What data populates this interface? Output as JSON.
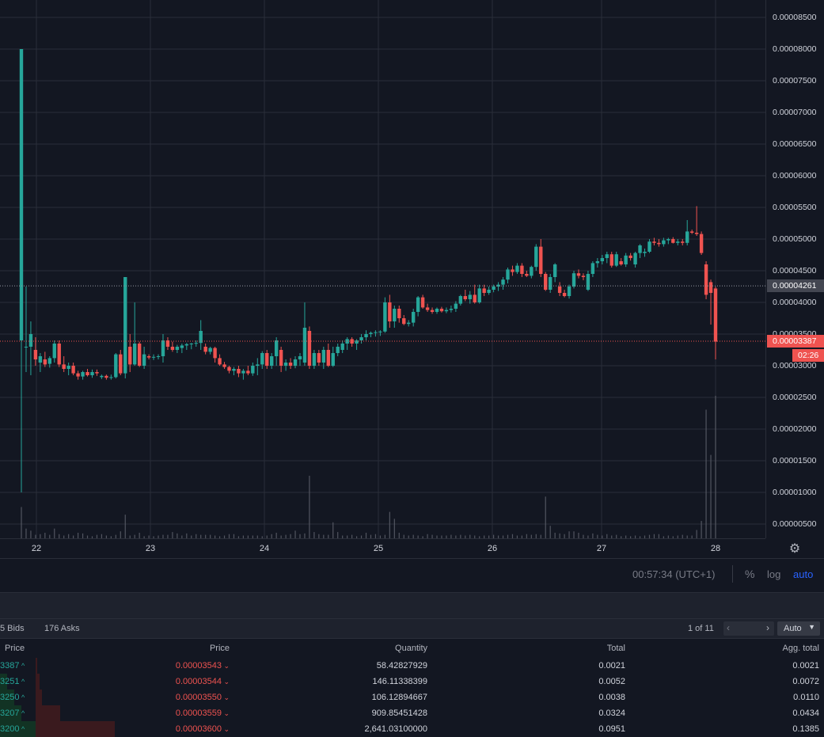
{
  "chart_data": {
    "type": "candlestick",
    "x_tick_labels": [
      "22",
      "23",
      "24",
      "25",
      "26",
      "27",
      "28"
    ],
    "y_tick_labels": [
      "0.00000500",
      "0.00001000",
      "0.00001500",
      "0.00002000",
      "0.00002500",
      "0.00003000",
      "0.00003500",
      "0.00004000",
      "0.00004500",
      "0.00005000",
      "0.00005500",
      "0.00006000",
      "0.00006500",
      "0.00007000",
      "0.00007500",
      "0.00008000",
      "0.00008500"
    ],
    "ylim": [
      3e-07,
      8.7e-06
    ],
    "scale": "linear",
    "grid": true,
    "candles": [
      [
        3.4e-05,
        8e-05,
        1e-05,
        8e-05
      ],
      [
        3.3e-05,
        4.25e-05,
        2.9e-05,
        3.3e-05
      ],
      [
        3.3e-05,
        3.7e-05,
        2.85e-05,
        3.5e-05
      ],
      [
        3.25e-05,
        3.45e-05,
        3e-05,
        3.1e-05
      ],
      [
        3.05e-05,
        3.2e-05,
        2.9e-05,
        3.15e-05
      ],
      [
        3.1e-05,
        3.22e-05,
        2.98e-05,
        3.02e-05
      ],
      [
        3.03e-05,
        3.15e-05,
        2.97e-05,
        3.12e-05
      ],
      [
        3.12e-05,
        3.4e-05,
        3.05e-05,
        3.35e-05
      ],
      [
        3.35e-05,
        3.4e-05,
        2.98e-05,
        3.02e-05
      ],
      [
        3.02e-05,
        3.15e-05,
        2.9e-05,
        2.95e-05
      ],
      [
        2.95e-05,
        3.05e-05,
        2.85e-05,
        3e-05
      ],
      [
        3e-05,
        3.05e-05,
        2.85e-05,
        2.88e-05
      ],
      [
        2.88e-05,
        2.92e-05,
        2.78e-05,
        2.83e-05
      ],
      [
        2.83e-05,
        2.92e-05,
        2.78e-05,
        2.9e-05
      ],
      [
        2.9e-05,
        2.95e-05,
        2.83e-05,
        2.85e-05
      ],
      [
        2.85e-05,
        2.94e-05,
        2.81e-05,
        2.9e-05
      ],
      [
        2.9e-05,
        2.94e-05,
        2.84e-05,
        2.88e-05
      ],
      [
        2.82e-05,
        2.86e-05,
        2.79e-05,
        2.84e-05
      ],
      [
        2.84e-05,
        2.86e-05,
        2.78e-05,
        2.81e-05
      ],
      [
        2.81e-05,
        2.86e-05,
        2.78e-05,
        2.82e-05
      ],
      [
        2.82e-05,
        3.2e-05,
        2.8e-05,
        3.18e-05
      ],
      [
        3.18e-05,
        3.25e-05,
        2.85e-05,
        2.88e-05
      ],
      [
        2.88e-05,
        4.4e-05,
        2.8e-05,
        4.4e-05
      ],
      [
        3.3e-05,
        3.5e-05,
        2.9e-05,
        3.02e-05
      ],
      [
        3.02e-05,
        4e-05,
        3e-05,
        3.35e-05
      ],
      [
        3.35e-05,
        3.38e-05,
        2.98e-05,
        3e-05
      ],
      [
        3e-05,
        3.3e-05,
        2.95e-05,
        3.18e-05
      ],
      [
        3.15e-05,
        3.18e-05,
        3.1e-05,
        3.13e-05
      ],
      [
        3.13e-05,
        3.18e-05,
        3.09e-05,
        3.14e-05
      ],
      [
        3.14e-05,
        3.18e-05,
        3.1e-05,
        3.15e-05
      ],
      [
        3.15e-05,
        3.5e-05,
        3.05e-05,
        3.4e-05
      ],
      [
        3.4e-05,
        3.45e-05,
        3.25e-05,
        3.3e-05
      ],
      [
        3.3e-05,
        3.38e-05,
        3.22e-05,
        3.25e-05
      ],
      [
        3.25e-05,
        3.33e-05,
        3.2e-05,
        3.3e-05
      ],
      [
        3.28e-05,
        3.35e-05,
        3.2e-05,
        3.32e-05
      ],
      [
        3.32e-05,
        3.36e-05,
        3.25e-05,
        3.34e-05
      ],
      [
        3.34e-05,
        3.36e-05,
        3.26e-05,
        3.35e-05
      ],
      [
        3.35e-05,
        3.4e-05,
        3.3e-05,
        3.36e-05
      ],
      [
        3.36e-05,
        3.72e-05,
        3.25e-05,
        3.55e-05
      ],
      [
        3.3e-05,
        3.35e-05,
        3.18e-05,
        3.22e-05
      ],
      [
        3.22e-05,
        3.3e-05,
        3.18e-05,
        3.28e-05
      ],
      [
        3.28e-05,
        3.3e-05,
        3.05e-05,
        3.12e-05
      ],
      [
        3.12e-05,
        3.18e-05,
        3e-05,
        3.02e-05
      ],
      [
        3.02e-05,
        3.06e-05,
        2.95e-05,
        2.98e-05
      ],
      [
        2.98e-05,
        3e-05,
        2.88e-05,
        2.92e-05
      ],
      [
        2.92e-05,
        2.98e-05,
        2.85e-05,
        2.95e-05
      ],
      [
        2.95e-05,
        3e-05,
        2.82e-05,
        2.88e-05
      ],
      [
        2.88e-05,
        2.95e-05,
        2.78e-05,
        2.92e-05
      ],
      [
        2.92e-05,
        3e-05,
        2.85e-05,
        2.88e-05
      ],
      [
        2.88e-05,
        3.05e-05,
        2.84e-05,
        3e-05
      ],
      [
        3e-05,
        3.12e-05,
        2.85e-05,
        3.02e-05
      ],
      [
        3.02e-05,
        3.23e-05,
        2.95e-05,
        3.2e-05
      ],
      [
        3.2e-05,
        3.25e-05,
        2.95e-05,
        3e-05
      ],
      [
        3e-05,
        3.2e-05,
        2.95e-05,
        3.15e-05
      ],
      [
        3.15e-05,
        3.45e-05,
        3e-05,
        3.4e-05
      ],
      [
        3.25e-05,
        3.3e-05,
        2.9e-05,
        3e-05
      ],
      [
        3e-05,
        3.1e-05,
        2.92e-05,
        3.05e-05
      ],
      [
        3.05e-05,
        3.12e-05,
        2.95e-05,
        3e-05
      ],
      [
        3e-05,
        3.15e-05,
        2.96e-05,
        3.1e-05
      ],
      [
        3.1e-05,
        3.2e-05,
        3e-05,
        3.15e-05
      ],
      [
        3.05e-05,
        4e-05,
        3e-05,
        3.6e-05
      ],
      [
        3.55e-05,
        3.62e-05,
        2.95e-05,
        3e-05
      ],
      [
        3e-05,
        3.25e-05,
        2.95e-05,
        3.2e-05
      ],
      [
        3.2e-05,
        3.25e-05,
        3e-05,
        3.05e-05
      ],
      [
        3.05e-05,
        3.3e-05,
        2.95e-05,
        3.25e-05
      ],
      [
        3.25e-05,
        3.35e-05,
        2.98e-05,
        3e-05
      ],
      [
        3e-05,
        3.3e-05,
        2.98e-05,
        3.2e-05
      ],
      [
        3.2e-05,
        3.35e-05,
        3.15e-05,
        3.3e-05
      ],
      [
        3.25e-05,
        3.4e-05,
        3.2e-05,
        3.35e-05
      ],
      [
        3.35e-05,
        3.45e-05,
        3.25e-05,
        3.42e-05
      ],
      [
        3.42e-05,
        3.45e-05,
        3.3e-05,
        3.35e-05
      ],
      [
        3.35e-05,
        3.42e-05,
        3.25e-05,
        3.4e-05
      ],
      [
        3.4e-05,
        3.5e-05,
        3.35e-05,
        3.45e-05
      ],
      [
        3.45e-05,
        3.56e-05,
        3.4e-05,
        3.5e-05
      ],
      [
        3.5e-05,
        3.54e-05,
        3.45e-05,
        3.52e-05
      ],
      [
        3.52e-05,
        3.56e-05,
        3.46e-05,
        3.53e-05
      ],
      [
        3.53e-05,
        3.56e-05,
        3.47e-05,
        3.54e-05
      ],
      [
        3.54e-05,
        4.08e-05,
        3.52e-05,
        4e-05
      ],
      [
        4e-05,
        4.12e-05,
        3.6e-05,
        3.7e-05
      ],
      [
        3.7e-05,
        3.95e-05,
        3.6e-05,
        3.9e-05
      ],
      [
        3.9e-05,
        3.95e-05,
        3.68e-05,
        3.75e-05
      ],
      [
        3.75e-05,
        3.8e-05,
        3.64e-05,
        3.66e-05
      ],
      [
        3.66e-05,
        3.72e-05,
        3.62e-05,
        3.68e-05
      ],
      [
        3.68e-05,
        3.9e-05,
        3.62e-05,
        3.85e-05
      ],
      [
        3.85e-05,
        4.1e-05,
        3.78e-05,
        4.08e-05
      ],
      [
        4.08e-05,
        4.12e-05,
        3.9e-05,
        3.92e-05
      ],
      [
        3.92e-05,
        3.98e-05,
        3.85e-05,
        3.88e-05
      ],
      [
        3.88e-05,
        3.92e-05,
        3.82e-05,
        3.85e-05
      ],
      [
        3.85e-05,
        3.92e-05,
        3.82e-05,
        3.9e-05
      ],
      [
        3.9e-05,
        3.93e-05,
        3.84e-05,
        3.86e-05
      ],
      [
        3.86e-05,
        3.92e-05,
        3.83e-05,
        3.88e-05
      ],
      [
        3.88e-05,
        3.95e-05,
        3.84e-05,
        3.9e-05
      ],
      [
        3.9e-05,
        4.02e-05,
        3.85e-05,
        3.98e-05
      ],
      [
        3.98e-05,
        4.12e-05,
        3.95e-05,
        4.1e-05
      ],
      [
        4.1e-05,
        4.2e-05,
        4.02e-05,
        4.05e-05
      ],
      [
        4.05e-05,
        4.18e-05,
        3.98e-05,
        4.12e-05
      ],
      [
        4.12e-05,
        4.28e-05,
        3.98e-05,
        4e-05
      ],
      [
        4e-05,
        4.28e-05,
        3.98e-05,
        4.22e-05
      ],
      [
        4.22e-05,
        4.28e-05,
        4.1e-05,
        4.15e-05
      ],
      [
        4.15e-05,
        4.25e-05,
        4.12e-05,
        4.2e-05
      ],
      [
        4.2e-05,
        4.28e-05,
        4.16e-05,
        4.25e-05
      ],
      [
        4.25e-05,
        4.32e-05,
        4.18e-05,
        4.28e-05
      ],
      [
        4.28e-05,
        4.4e-05,
        4.2e-05,
        4.36e-05
      ],
      [
        4.36e-05,
        4.55e-05,
        4.3e-05,
        4.52e-05
      ],
      [
        4.52e-05,
        4.58e-05,
        4.42e-05,
        4.48e-05
      ],
      [
        4.48e-05,
        4.62e-05,
        4.45e-05,
        4.58e-05
      ],
      [
        4.58e-05,
        4.62e-05,
        4.4e-05,
        4.45e-05
      ],
      [
        4.45e-05,
        4.5e-05,
        4.4e-05,
        4.42e-05
      ],
      [
        4.42e-05,
        4.58e-05,
        4.38e-05,
        4.56e-05
      ],
      [
        4.56e-05,
        4.92e-05,
        4.5e-05,
        4.88e-05
      ],
      [
        4.88e-05,
        5e-05,
        4.4e-05,
        4.45e-05
      ],
      [
        4.45e-05,
        4.48e-05,
        4.18e-05,
        4.2e-05
      ],
      [
        4.2e-05,
        4.45e-05,
        4.15e-05,
        4.4e-05
      ],
      [
        4.4e-05,
        4.62e-05,
        4.32e-05,
        4.6e-05
      ],
      [
        4.25e-05,
        4.32e-05,
        4.1e-05,
        4.15e-05
      ],
      [
        4.15e-05,
        4.2e-05,
        4.08e-05,
        4.1e-05
      ],
      [
        4.1e-05,
        4.28e-05,
        4.06e-05,
        4.25e-05
      ],
      [
        4.25e-05,
        4.5e-05,
        4.22e-05,
        4.46e-05
      ],
      [
        4.46e-05,
        4.52e-05,
        4.38e-05,
        4.42e-05
      ],
      [
        4.42e-05,
        4.46e-05,
        4.35e-05,
        4.4e-05
      ],
      [
        4.2e-05,
        4.5e-05,
        4.18e-05,
        4.45e-05
      ],
      [
        4.45e-05,
        4.65e-05,
        4.4e-05,
        4.62e-05
      ],
      [
        4.62e-05,
        4.7e-05,
        4.55e-05,
        4.65e-05
      ],
      [
        4.65e-05,
        4.75e-05,
        4.6e-05,
        4.7e-05
      ],
      [
        4.7e-05,
        4.8e-05,
        4.62e-05,
        4.76e-05
      ],
      [
        4.76e-05,
        4.8e-05,
        4.55e-05,
        4.58e-05
      ],
      [
        4.58e-05,
        4.8e-05,
        4.56e-05,
        4.76e-05
      ],
      [
        4.65e-05,
        4.7e-05,
        4.58e-05,
        4.6e-05
      ],
      [
        4.6e-05,
        4.78e-05,
        4.56e-05,
        4.74e-05
      ],
      [
        4.74e-05,
        4.78e-05,
        4.66e-05,
        4.7e-05
      ],
      [
        4.6e-05,
        4.8e-05,
        4.55e-05,
        4.78e-05
      ],
      [
        4.78e-05,
        4.92e-05,
        4.7e-05,
        4.9e-05
      ],
      [
        4.78e-05,
        4.85e-05,
        4.72e-05,
        4.8e-05
      ],
      [
        4.8e-05,
        5e-05,
        4.78e-05,
        4.96e-05
      ],
      [
        4.96e-05,
        5.02e-05,
        4.9e-05,
        4.94e-05
      ],
      [
        4.94e-05,
        5e-05,
        4.88e-05,
        4.92e-05
      ],
      [
        4.92e-05,
        5.02e-05,
        4.88e-05,
        4.98e-05
      ],
      [
        4.98e-05,
        5.02e-05,
        4.92e-05,
        5e-05
      ],
      [
        5e-05,
        5.03e-05,
        4.93e-05,
        4.94e-05
      ],
      [
        4.94e-05,
        5e-05,
        4.9e-05,
        4.96e-05
      ],
      [
        4.96e-05,
        5e-05,
        4.9e-05,
        4.94e-05
      ],
      [
        4.94e-05,
        5.3e-05,
        4.9e-05,
        5.12e-05
      ],
      [
        5.12e-05,
        5.15e-05,
        5.08e-05,
        5.1e-05
      ],
      [
        5.1e-05,
        5.52e-05,
        5.05e-05,
        5.08e-05
      ],
      [
        5.08e-05,
        5.12e-05,
        4.75e-05,
        4.78e-05
      ],
      [
        4.6e-05,
        4.65e-05,
        4.05e-05,
        4.12e-05
      ],
      [
        4.32e-05,
        4.36e-05,
        3.65e-05,
        4.15e-05
      ],
      [
        4.22e-05,
        4.25e-05,
        3.1e-05,
        3.38e-05
      ]
    ],
    "volumes": [
      45,
      14,
      11,
      5,
      6,
      8,
      5,
      14,
      6,
      4,
      6,
      4,
      8,
      7,
      4,
      3,
      5,
      6,
      4,
      3,
      5,
      10,
      34,
      4,
      5,
      8,
      3,
      4,
      3,
      4,
      5,
      5,
      9,
      7,
      4,
      7,
      4,
      6,
      5,
      5,
      5,
      4,
      3,
      4,
      6,
      6,
      3,
      4,
      4,
      4,
      4,
      3,
      4,
      6,
      8,
      4,
      5,
      6,
      11,
      6,
      7,
      90,
      9,
      6,
      5,
      5,
      23,
      9,
      4,
      4,
      5,
      3,
      4,
      8,
      5,
      6,
      4,
      5,
      38,
      28,
      8,
      5,
      4,
      5,
      4,
      3,
      6,
      5,
      4,
      4,
      4,
      5,
      4,
      5,
      4,
      5,
      4,
      3,
      4,
      4,
      5,
      4,
      4,
      5,
      6,
      4,
      4,
      6,
      5,
      6,
      5,
      60,
      18,
      8,
      7,
      6,
      10,
      10,
      8,
      5,
      4,
      7,
      5,
      4,
      6,
      4,
      5,
      3,
      4,
      3,
      4,
      3,
      4,
      5,
      6,
      6,
      3,
      4,
      3,
      4,
      5,
      4,
      4,
      12,
      25,
      185,
      120,
      205
    ],
    "vol_max": 205,
    "last_price_label": "0.00003387",
    "last_price": 3.387e-05,
    "countdown": "02:26",
    "reference_price_label": "0.00004261",
    "reference_price": 4.261e-05
  },
  "colors": {
    "up": "#26a69a",
    "down": "#ef5350",
    "background": "#131722",
    "grid": "#2a2e39"
  },
  "status": {
    "time": "00:57:34 (UTC+1)",
    "percent": "%",
    "log": "log",
    "auto": "auto"
  },
  "orderbook": {
    "bids_tab": "5 Bids",
    "asks_tab": "176 Asks",
    "pager": "1 of 11",
    "pager_prev": "‹",
    "pager_next": "›",
    "mode": "Auto",
    "headers": {
      "bid_price": "Price",
      "ask_price": "Price",
      "quantity": "Quantity",
      "total": "Total",
      "agg_total": "Agg. total"
    },
    "rows": [
      {
        "bid_price": "3387",
        "ask_price": "0.00003543",
        "quantity": "58.42827929",
        "total": "0.0021",
        "agg_total": "0.0021",
        "bid_depth": 0.0,
        "ask_depth": 0.015
      },
      {
        "bid_price": "3251",
        "ask_price": "0.00003544",
        "quantity": "146.11338399",
        "total": "0.0052",
        "agg_total": "0.0072",
        "bid_depth": 0.2,
        "ask_depth": 0.052
      },
      {
        "bid_price": "3250",
        "ask_price": "0.00003550",
        "quantity": "106.12894667",
        "total": "0.0038",
        "agg_total": "0.0110",
        "bid_depth": 0.4,
        "ask_depth": 0.079
      },
      {
        "bid_price": "3207",
        "ask_price": "0.00003559",
        "quantity": "909.85451428",
        "total": "0.0324",
        "agg_total": "0.0434",
        "bid_depth": 0.6,
        "ask_depth": 0.313
      },
      {
        "bid_price": "3200",
        "ask_price": "0.00003600",
        "quantity": "2,641.03100000",
        "total": "0.0951",
        "agg_total": "0.1385",
        "bid_depth": 1.0,
        "ask_depth": 1.0
      }
    ]
  }
}
